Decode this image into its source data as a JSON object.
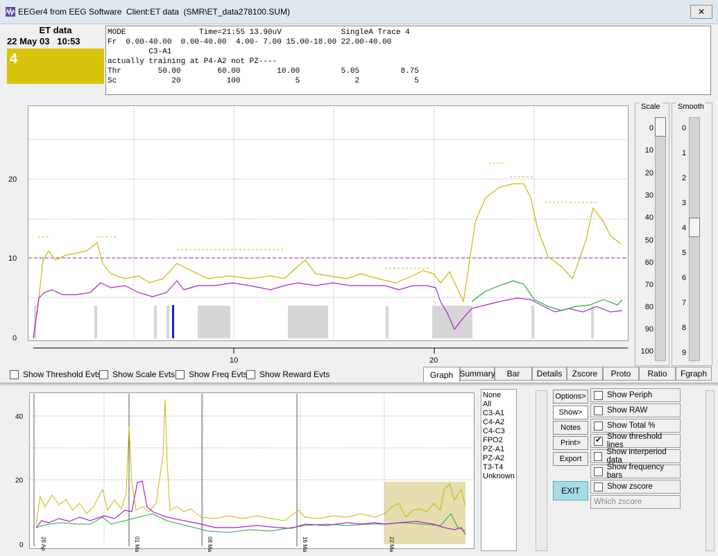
{
  "window": {
    "title": "EEGer4 from EEG Software  Client:ET data  (SMR\\ET_data278100.SUM)",
    "close_symbol": "✕"
  },
  "client": {
    "name": "ET data",
    "date": "22 May 03",
    "time": "10:53",
    "trace_number": "4",
    "trace_color": "#d8c50b"
  },
  "info_panel": {
    "lines": [
      "MODE                Time=21:55 13.90uV             SingleA Trace 4",
      "Fr  0.00-40.00  0.00-40.00  4.00- 7.00 15.00-18.00 22.00-40.00",
      "         C3-A1",
      "actually training at P4-A2 not PZ----",
      "Thr        50.00        60.00        10.00         5.05         8.75",
      "Sc            20          100            5            2            5"
    ]
  },
  "main_chart": {
    "y_ticks": [
      "0",
      "10",
      "20"
    ],
    "x_ticks": [
      "10",
      "20"
    ]
  },
  "checkboxes": [
    {
      "label": "Show Threshold Evts",
      "checked": false
    },
    {
      "label": "Show Scale Evts",
      "checked": false
    },
    {
      "label": "Show Freq Evts",
      "checked": false
    },
    {
      "label": "Show Reward Evts",
      "checked": false
    }
  ],
  "tabs": [
    "Graph",
    "Summary",
    "Bar",
    "Details",
    "Zscore",
    "Proto",
    "Ratio",
    "Fgraph"
  ],
  "active_tab": "Graph",
  "scale": {
    "title": "Scale",
    "values": [
      "0",
      "10",
      "20",
      "30",
      "40",
      "50",
      "60",
      "70",
      "80",
      "90",
      "100"
    ],
    "current": "0"
  },
  "smooth": {
    "title": "Smooth",
    "values": [
      "0",
      "1",
      "2",
      "3",
      "4",
      "5",
      "6",
      "7",
      "8",
      "9"
    ],
    "current": "4"
  },
  "lower_chart": {
    "y_ticks": [
      "0",
      "20",
      "40"
    ],
    "x_date_labels": [
      "28 Ap",
      "01 Ma",
      "08 Ma",
      "16 Ma",
      "22 Ma"
    ]
  },
  "site_list": [
    "None",
    "All",
    "C3-A1",
    "C4-A2",
    "C4-C3",
    "FPO2",
    "PZ-A1",
    "PZ-A2",
    "T3-T4",
    "Unknown"
  ],
  "buttons": {
    "options": "Options>",
    "show": "Show>",
    "notes": "Notes",
    "print": "Print>",
    "export": "Export",
    "exit": "EXIT"
  },
  "show_options": [
    {
      "label": "Show Periph",
      "checked": false
    },
    {
      "label": "Show RAW",
      "checked": false
    },
    {
      "label": "Show Total %",
      "checked": false
    },
    {
      "label": "Show threshold lines",
      "checked": true
    },
    {
      "label": "Show interperiod data",
      "checked": false
    },
    {
      "label": "Show frequency bars",
      "checked": false
    },
    {
      "label": "Show zscore",
      "checked": false
    }
  ],
  "which_zscore": "Which zscore",
  "colors": {
    "yellow_trace": "#c9b800",
    "magenta_trace": "#b01ec8",
    "green_trace": "#20a838",
    "threshold_line": "#a020a0",
    "reward_block": "#d6d6d6",
    "highlight_range": "#e6ddb0"
  }
}
